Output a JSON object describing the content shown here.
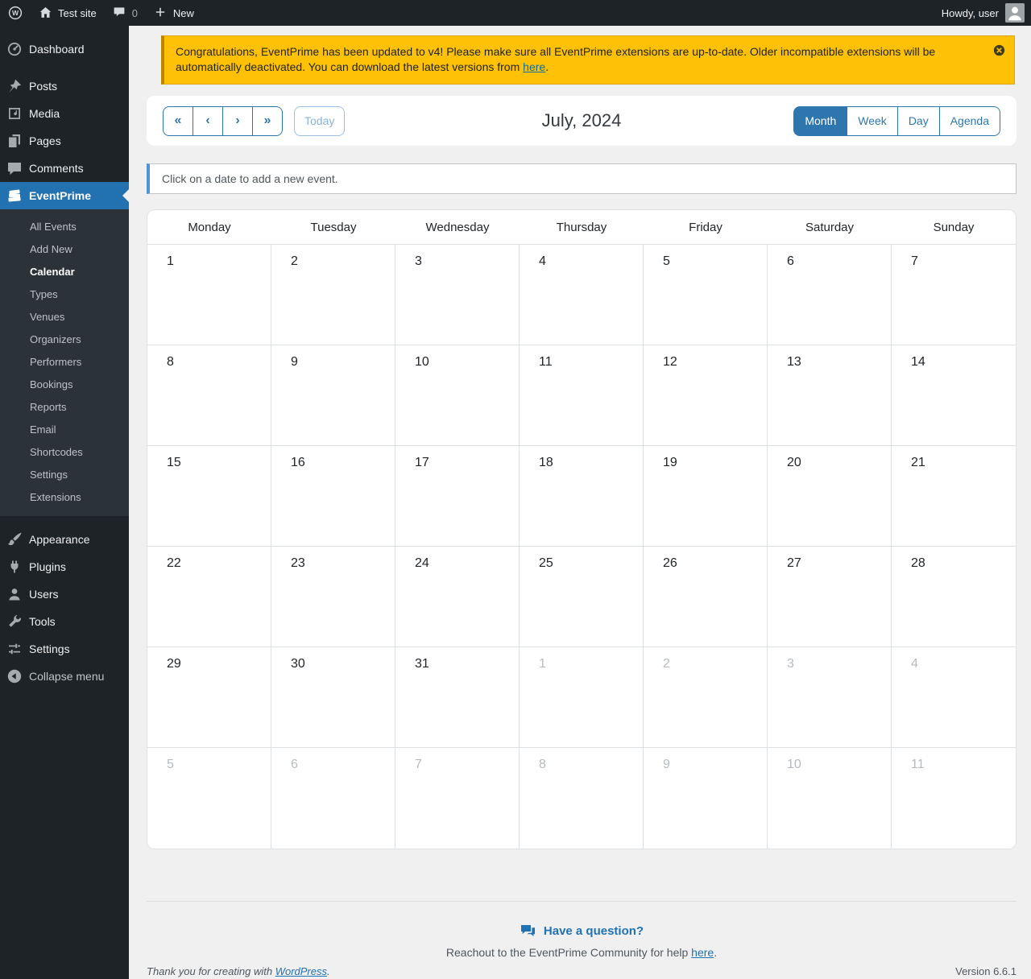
{
  "admin_bar": {
    "site_name": "Test site",
    "comment_count": "0",
    "new_label": "New",
    "howdy": "Howdy, user"
  },
  "sidebar": {
    "items": [
      {
        "label": "Dashboard",
        "icon": "dashboard-icon",
        "sep_after": true
      },
      {
        "label": "Posts",
        "icon": "pin-icon"
      },
      {
        "label": "Media",
        "icon": "media-icon"
      },
      {
        "label": "Pages",
        "icon": "pages-icon"
      },
      {
        "label": "Comments",
        "icon": "comments-icon"
      },
      {
        "label": "EventPrime",
        "icon": "tickets-icon",
        "active": true,
        "submenu": [
          "All Events",
          "Add New",
          "Calendar",
          "Types",
          "Venues",
          "Organizers",
          "Performers",
          "Bookings",
          "Reports",
          "Email",
          "Shortcodes",
          "Settings",
          "Extensions"
        ],
        "submenu_active": "Calendar",
        "sep_after": true
      },
      {
        "label": "Appearance",
        "icon": "brush-icon"
      },
      {
        "label": "Plugins",
        "icon": "plugin-icon"
      },
      {
        "label": "Users",
        "icon": "user-icon"
      },
      {
        "label": "Tools",
        "icon": "wrench-icon"
      },
      {
        "label": "Settings",
        "icon": "sliders-icon"
      },
      {
        "label": "Collapse menu",
        "icon": "collapse-icon",
        "collapse": true
      }
    ]
  },
  "notice": {
    "text": "Congratulations, EventPrime has been updated to v4! Please make sure all EventPrime extensions are up-to-date. Older incompatible extensions will be automatically deactivated. You can download the latest versions from ",
    "link_text": "here",
    "suffix": "."
  },
  "toolbar": {
    "nav": [
      {
        "name": "first",
        "glyph": "«"
      },
      {
        "name": "prev",
        "glyph": "‹"
      },
      {
        "name": "next",
        "glyph": "›"
      },
      {
        "name": "last",
        "glyph": "»"
      }
    ],
    "today_label": "Today",
    "title": "July, 2024",
    "views": [
      {
        "label": "Month",
        "active": true
      },
      {
        "label": "Week"
      },
      {
        "label": "Day"
      },
      {
        "label": "Agenda"
      }
    ]
  },
  "info_message": "Click on a date to add a new event.",
  "calendar": {
    "day_headers": [
      "Monday",
      "Tuesday",
      "Wednesday",
      "Thursday",
      "Friday",
      "Saturday",
      "Sunday"
    ],
    "weeks": [
      [
        {
          "d": "1"
        },
        {
          "d": "2"
        },
        {
          "d": "3"
        },
        {
          "d": "4"
        },
        {
          "d": "5"
        },
        {
          "d": "6"
        },
        {
          "d": "7"
        }
      ],
      [
        {
          "d": "8"
        },
        {
          "d": "9"
        },
        {
          "d": "10"
        },
        {
          "d": "11"
        },
        {
          "d": "12"
        },
        {
          "d": "13"
        },
        {
          "d": "14"
        }
      ],
      [
        {
          "d": "15"
        },
        {
          "d": "16"
        },
        {
          "d": "17"
        },
        {
          "d": "18"
        },
        {
          "d": "19"
        },
        {
          "d": "20"
        },
        {
          "d": "21"
        }
      ],
      [
        {
          "d": "22"
        },
        {
          "d": "23"
        },
        {
          "d": "24"
        },
        {
          "d": "25"
        },
        {
          "d": "26"
        },
        {
          "d": "27"
        },
        {
          "d": "28"
        }
      ],
      [
        {
          "d": "29"
        },
        {
          "d": "30"
        },
        {
          "d": "31"
        },
        {
          "d": "1",
          "muted": true
        },
        {
          "d": "2",
          "muted": true
        },
        {
          "d": "3",
          "muted": true
        },
        {
          "d": "4",
          "muted": true
        }
      ],
      [
        {
          "d": "5",
          "muted": true
        },
        {
          "d": "6",
          "muted": true
        },
        {
          "d": "7",
          "muted": true
        },
        {
          "d": "8",
          "muted": true
        },
        {
          "d": "9",
          "muted": true
        },
        {
          "d": "10",
          "muted": true
        },
        {
          "d": "11",
          "muted": true
        }
      ]
    ]
  },
  "footer": {
    "question_title": "Have a question?",
    "community_text": "Reachout to the EventPrime Community for help ",
    "community_link": "here",
    "community_suffix": ".",
    "thanks_text": "Thank you for creating with ",
    "thanks_link": "WordPress",
    "thanks_suffix": ".",
    "version": "Version 6.6.1"
  },
  "colors": {
    "accent": "#2271b1",
    "calendar_blue": "#2e77ae",
    "notice_bg": "#ffc106",
    "notice_border": "#dba617",
    "sidebar_bg": "#1d2327",
    "submenu_bg": "#2c3338",
    "content_bg": "#f0f0f1",
    "muted_day_color": "#b5bbc0"
  }
}
